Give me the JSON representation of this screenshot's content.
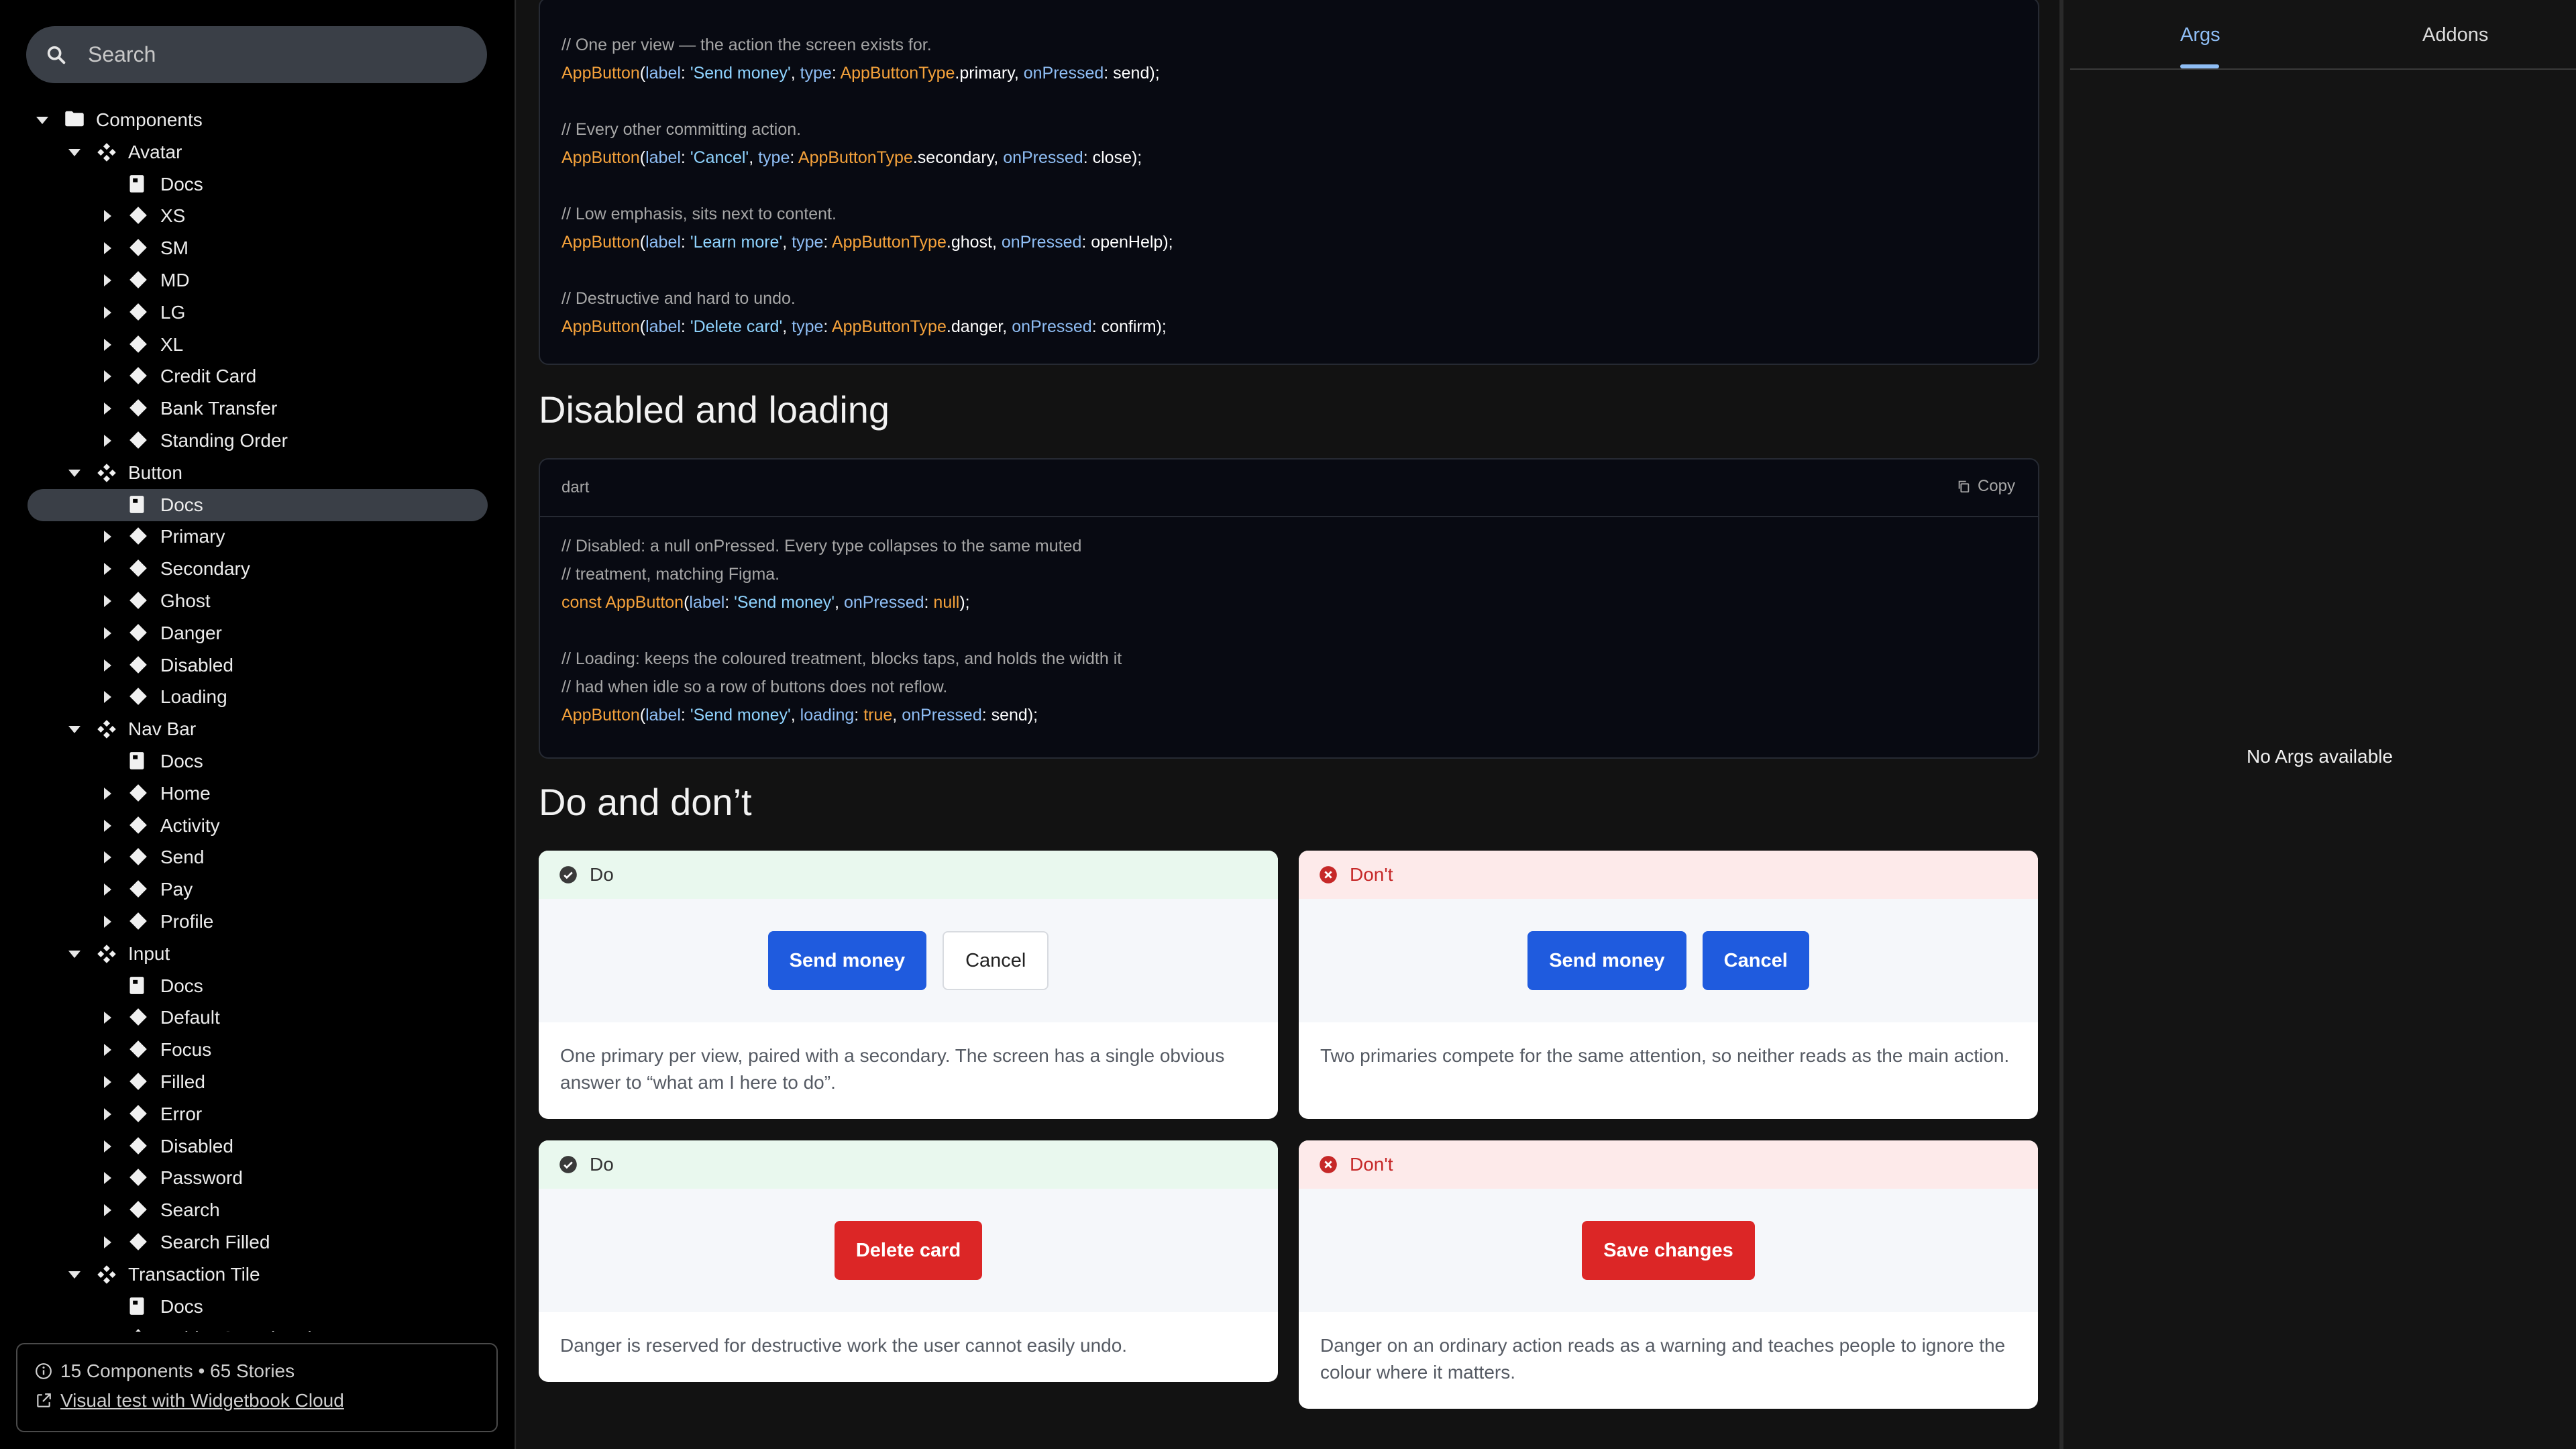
{
  "sidebar": {
    "search_placeholder": "Search",
    "tree": [
      {
        "label": "Components",
        "level": 0,
        "icon": "folder-icon",
        "arrow": "down"
      },
      {
        "label": "Avatar",
        "level": 1,
        "icon": "component-icon",
        "arrow": "down"
      },
      {
        "label": "Docs",
        "level": 2,
        "icon": "docs-icon",
        "arrow": "none"
      },
      {
        "label": "XS",
        "level": 2,
        "icon": "story-icon",
        "arrow": "right"
      },
      {
        "label": "SM",
        "level": 2,
        "icon": "story-icon",
        "arrow": "right"
      },
      {
        "label": "MD",
        "level": 2,
        "icon": "story-icon",
        "arrow": "right"
      },
      {
        "label": "LG",
        "level": 2,
        "icon": "story-icon",
        "arrow": "right"
      },
      {
        "label": "XL",
        "level": 2,
        "icon": "story-icon",
        "arrow": "right"
      },
      {
        "label": "Credit Card",
        "level": 2,
        "icon": "story-icon",
        "arrow": "right"
      },
      {
        "label": "Bank Transfer",
        "level": 2,
        "icon": "story-icon",
        "arrow": "right"
      },
      {
        "label": "Standing Order",
        "level": 2,
        "icon": "story-icon",
        "arrow": "right"
      },
      {
        "label": "Button",
        "level": 1,
        "icon": "component-icon",
        "arrow": "down"
      },
      {
        "label": "Docs",
        "level": 2,
        "icon": "docs-icon",
        "arrow": "none",
        "selected": true
      },
      {
        "label": "Primary",
        "level": 2,
        "icon": "story-icon",
        "arrow": "right"
      },
      {
        "label": "Secondary",
        "level": 2,
        "icon": "story-icon",
        "arrow": "right"
      },
      {
        "label": "Ghost",
        "level": 2,
        "icon": "story-icon",
        "arrow": "right"
      },
      {
        "label": "Danger",
        "level": 2,
        "icon": "story-icon",
        "arrow": "right"
      },
      {
        "label": "Disabled",
        "level": 2,
        "icon": "story-icon",
        "arrow": "right"
      },
      {
        "label": "Loading",
        "level": 2,
        "icon": "story-icon",
        "arrow": "right"
      },
      {
        "label": "Nav Bar",
        "level": 1,
        "icon": "component-icon",
        "arrow": "down"
      },
      {
        "label": "Docs",
        "level": 2,
        "icon": "docs-icon",
        "arrow": "none"
      },
      {
        "label": "Home",
        "level": 2,
        "icon": "story-icon",
        "arrow": "right"
      },
      {
        "label": "Activity",
        "level": 2,
        "icon": "story-icon",
        "arrow": "right"
      },
      {
        "label": "Send",
        "level": 2,
        "icon": "story-icon",
        "arrow": "right"
      },
      {
        "label": "Pay",
        "level": 2,
        "icon": "story-icon",
        "arrow": "right"
      },
      {
        "label": "Profile",
        "level": 2,
        "icon": "story-icon",
        "arrow": "right"
      },
      {
        "label": "Input",
        "level": 1,
        "icon": "component-icon",
        "arrow": "down"
      },
      {
        "label": "Docs",
        "level": 2,
        "icon": "docs-icon",
        "arrow": "none"
      },
      {
        "label": "Default",
        "level": 2,
        "icon": "story-icon",
        "arrow": "right"
      },
      {
        "label": "Focus",
        "level": 2,
        "icon": "story-icon",
        "arrow": "right"
      },
      {
        "label": "Filled",
        "level": 2,
        "icon": "story-icon",
        "arrow": "right"
      },
      {
        "label": "Error",
        "level": 2,
        "icon": "story-icon",
        "arrow": "right"
      },
      {
        "label": "Disabled",
        "level": 2,
        "icon": "story-icon",
        "arrow": "right"
      },
      {
        "label": "Password",
        "level": 2,
        "icon": "story-icon",
        "arrow": "right"
      },
      {
        "label": "Search",
        "level": 2,
        "icon": "story-icon",
        "arrow": "right"
      },
      {
        "label": "Search Filled",
        "level": 2,
        "icon": "story-icon",
        "arrow": "right"
      },
      {
        "label": "Transaction Tile",
        "level": 1,
        "icon": "component-icon",
        "arrow": "down"
      },
      {
        "label": "Docs",
        "level": 2,
        "icon": "docs-icon",
        "arrow": "none"
      },
      {
        "label": "Debit · Completed",
        "level": 2,
        "icon": "story-icon",
        "arrow": "right"
      }
    ],
    "footer": {
      "summary": "15 Components • 65 Stories",
      "link_label": "Visual test with Widgetbook Cloud"
    }
  },
  "main": {
    "top_code_lines": [
      [
        {
          "t": "// One per view — the action the screen exists for.",
          "c": "c-com"
        }
      ],
      [
        {
          "t": "AppButton",
          "c": "c-cls"
        },
        {
          "t": "(",
          "c": ""
        },
        {
          "t": "label",
          "c": "c-key"
        },
        {
          "t": ": ",
          "c": ""
        },
        {
          "t": "'Send money'",
          "c": "c-str"
        },
        {
          "t": ", ",
          "c": ""
        },
        {
          "t": "type",
          "c": "c-key"
        },
        {
          "t": ": ",
          "c": ""
        },
        {
          "t": "AppButtonType",
          "c": "c-cls"
        },
        {
          "t": ".primary, ",
          "c": ""
        },
        {
          "t": "onPressed",
          "c": "c-key"
        },
        {
          "t": ": send);",
          "c": ""
        }
      ],
      [],
      [
        {
          "t": "// Every other committing action.",
          "c": "c-com"
        }
      ],
      [
        {
          "t": "AppButton",
          "c": "c-cls"
        },
        {
          "t": "(",
          "c": ""
        },
        {
          "t": "label",
          "c": "c-key"
        },
        {
          "t": ": ",
          "c": ""
        },
        {
          "t": "'Cancel'",
          "c": "c-str"
        },
        {
          "t": ", ",
          "c": ""
        },
        {
          "t": "type",
          "c": "c-key"
        },
        {
          "t": ": ",
          "c": ""
        },
        {
          "t": "AppButtonType",
          "c": "c-cls"
        },
        {
          "t": ".secondary, ",
          "c": ""
        },
        {
          "t": "onPressed",
          "c": "c-key"
        },
        {
          "t": ": close);",
          "c": ""
        }
      ],
      [],
      [
        {
          "t": "// Low emphasis, sits next to content.",
          "c": "c-com"
        }
      ],
      [
        {
          "t": "AppButton",
          "c": "c-cls"
        },
        {
          "t": "(",
          "c": ""
        },
        {
          "t": "label",
          "c": "c-key"
        },
        {
          "t": ": ",
          "c": ""
        },
        {
          "t": "'Learn more'",
          "c": "c-str"
        },
        {
          "t": ", ",
          "c": ""
        },
        {
          "t": "type",
          "c": "c-key"
        },
        {
          "t": ": ",
          "c": ""
        },
        {
          "t": "AppButtonType",
          "c": "c-cls"
        },
        {
          "t": ".ghost, ",
          "c": ""
        },
        {
          "t": "onPressed",
          "c": "c-key"
        },
        {
          "t": ": openHelp);",
          "c": ""
        }
      ],
      [],
      [
        {
          "t": "// Destructive and hard to undo.",
          "c": "c-com"
        }
      ],
      [
        {
          "t": "AppButton",
          "c": "c-cls"
        },
        {
          "t": "(",
          "c": ""
        },
        {
          "t": "label",
          "c": "c-key"
        },
        {
          "t": ": ",
          "c": ""
        },
        {
          "t": "'Delete card'",
          "c": "c-str"
        },
        {
          "t": ", ",
          "c": ""
        },
        {
          "t": "type",
          "c": "c-key"
        },
        {
          "t": ": ",
          "c": ""
        },
        {
          "t": "AppButtonType",
          "c": "c-cls"
        },
        {
          "t": ".danger, ",
          "c": ""
        },
        {
          "t": "onPressed",
          "c": "c-key"
        },
        {
          "t": ": confirm);",
          "c": ""
        }
      ]
    ],
    "section_disabled_title": "Disabled and loading",
    "code2_lang": "dart",
    "copy_label": "Copy",
    "code2_lines": [
      [
        {
          "t": "// Disabled: a null onPressed. Every type collapses to the same muted",
          "c": "c-com"
        }
      ],
      [
        {
          "t": "// treatment, matching Figma.",
          "c": "c-com"
        }
      ],
      [
        {
          "t": "const ",
          "c": "c-kw"
        },
        {
          "t": "AppButton",
          "c": "c-cls"
        },
        {
          "t": "(",
          "c": ""
        },
        {
          "t": "label",
          "c": "c-key"
        },
        {
          "t": ": ",
          "c": ""
        },
        {
          "t": "'Send money'",
          "c": "c-str"
        },
        {
          "t": ", ",
          "c": ""
        },
        {
          "t": "onPressed",
          "c": "c-key"
        },
        {
          "t": ": ",
          "c": ""
        },
        {
          "t": "null",
          "c": "c-kw"
        },
        {
          "t": ");",
          "c": ""
        }
      ],
      [],
      [
        {
          "t": "// Loading: keeps the coloured treatment, blocks taps, and holds the width it",
          "c": "c-com"
        }
      ],
      [
        {
          "t": "// had when idle so a row of buttons does not reflow.",
          "c": "c-com"
        }
      ],
      [
        {
          "t": "AppButton",
          "c": "c-cls"
        },
        {
          "t": "(",
          "c": ""
        },
        {
          "t": "label",
          "c": "c-key"
        },
        {
          "t": ": ",
          "c": ""
        },
        {
          "t": "'Send money'",
          "c": "c-str"
        },
        {
          "t": ", ",
          "c": ""
        },
        {
          "t": "loading",
          "c": "c-key"
        },
        {
          "t": ": ",
          "c": ""
        },
        {
          "t": "true",
          "c": "c-kw"
        },
        {
          "t": ", ",
          "c": ""
        },
        {
          "t": "onPressed",
          "c": "c-key"
        },
        {
          "t": ": send);",
          "c": ""
        }
      ]
    ],
    "section_do_title": "Do and don’t",
    "cards": {
      "do1": {
        "heading": "Do",
        "buttons": [
          "Send money",
          "Cancel"
        ],
        "desc": "One primary per view, paired with a secondary. The screen has a single obvious answer to “what am I here to do”."
      },
      "dont1": {
        "heading": "Don't",
        "buttons": [
          "Send money",
          "Cancel"
        ],
        "desc": "Two primaries compete for the same attention, so neither reads as the main action."
      },
      "do2": {
        "heading": "Do",
        "buttons": [
          "Delete card"
        ],
        "desc": "Danger is reserved for destructive work the user cannot easily undo."
      },
      "dont2": {
        "heading": "Don't",
        "buttons": [
          "Save changes"
        ],
        "desc": "Danger on an ordinary action reads as a warning and teaches people to ignore the colour where it matters."
      }
    }
  },
  "right_panel": {
    "tabs": [
      "Args",
      "Addons"
    ],
    "active_tab": "Args",
    "empty_message": "No Args available"
  },
  "colors": {
    "primary": "#1f5bde",
    "danger": "#dc2626",
    "accent_tab": "#8fbef5",
    "do_header": "#e9f8ee",
    "dont_header": "#fdeaea"
  }
}
